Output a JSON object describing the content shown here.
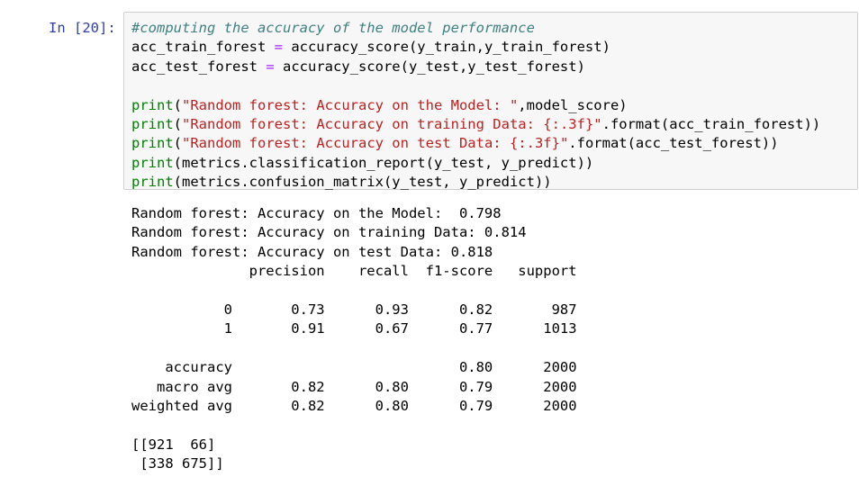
{
  "cell": {
    "prompt": "In [20]:",
    "code": {
      "comment": "#computing the accuracy of the model performance",
      "line2_lhs": "acc_train_forest ",
      "line2_op": "=",
      "line2_rhs": " accuracy_score(y_train,y_train_forest)",
      "line3_lhs": "acc_test_forest ",
      "line3_op": "=",
      "line3_rhs": " accuracy_score(y_test,y_test_forest)",
      "print_kw": "print",
      "p1_open": "(",
      "p1_str": "\"Random forest: Accuracy on the Model: \"",
      "p1_rest": ",model_score)",
      "p2_open": "(",
      "p2_str": "\"Random forest: Accuracy on training Data: {:.3f}\"",
      "p2_rest": ".format(acc_train_forest))",
      "p3_open": "(",
      "p3_str": "\"Random forest: Accuracy on test Data: {:.3f}\"",
      "p3_rest": ".format(acc_test_forest))",
      "p4_rest": "(metrics.classification_report(y_test, y_predict))",
      "p5_rest": "(metrics.confusion_matrix(y_test, y_predict))"
    }
  },
  "output": {
    "lines": [
      "Random forest: Accuracy on the Model:  0.798",
      "Random forest: Accuracy on training Data: 0.814",
      "Random forest: Accuracy on test Data: 0.818",
      "              precision    recall  f1-score   support",
      "",
      "           0       0.73      0.93      0.82       987",
      "           1       0.91      0.67      0.77      1013",
      "",
      "    accuracy                           0.80      2000",
      "   macro avg       0.82      0.80      0.79      2000",
      "weighted avg       0.82      0.80      0.79      2000",
      "",
      "[[921  66]",
      " [338 675]]"
    ]
  }
}
